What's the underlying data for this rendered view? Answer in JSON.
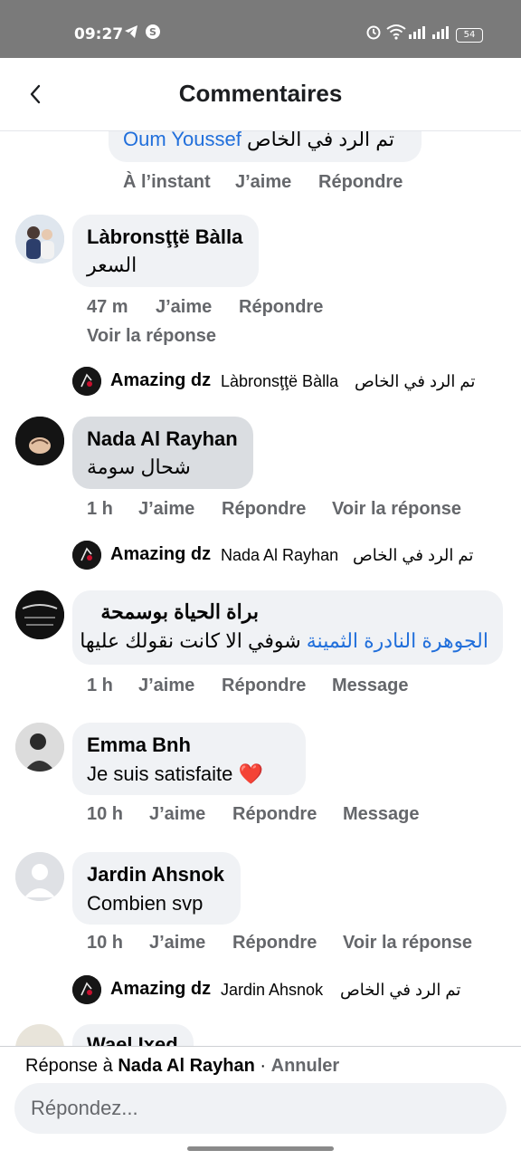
{
  "status": {
    "time": "09:27",
    "battery": "54",
    "icons": [
      "telegram-icon",
      "shazam-icon",
      "alarm-icon",
      "wifi-icon",
      "signal-icon",
      "signal-icon",
      "battery-icon"
    ]
  },
  "header": {
    "title": "Commentaires",
    "back_icon": "back-arrow-icon"
  },
  "comments": [
    {
      "reply_text_rtl": "تم الرد في الخاص",
      "mention": "Oum Youssef",
      "time": "À l’instant",
      "like": "J’aime",
      "reply": "Répondre"
    },
    {
      "name": "Làbronsţţë Bàlla",
      "text": "السعر",
      "time": "47 m",
      "like": "J’aime",
      "reply": "Répondre",
      "see_reply": "Voir la réponse",
      "sub_reply": {
        "name": "Amazing dz",
        "mention": "Làbronsţţë Bàlla",
        "text": "تم الرد في الخاص"
      }
    },
    {
      "name": "Nada Al Rayhan",
      "text": "شحال سومة",
      "time": "1 h",
      "like": "J’aime",
      "reply": "Répondre",
      "see_reply": "Voir la réponse",
      "sub_reply": {
        "name": "Amazing dz",
        "mention": "Nada Al Rayhan",
        "text": "تم الرد في الخاص"
      }
    },
    {
      "name": "براة الحياة بوسمحة",
      "mention": "الجوهرة النادرة الثمينة",
      "text": "شوفي الا كانت نقولك عليها",
      "time": "1 h",
      "like": "J’aime",
      "reply": "Répondre",
      "message": "Message"
    },
    {
      "name": "Emma Bnh",
      "text": "Je suis satisfaite ❤️",
      "time": "10 h",
      "like": "J’aime",
      "reply": "Répondre",
      "message": "Message"
    },
    {
      "name": "Jardin Ahsnok",
      "text": "Combien svp",
      "time": "10 h",
      "like": "J’aime",
      "reply": "Répondre",
      "see_reply": "Voir la réponse",
      "sub_reply": {
        "name": "Amazing dz",
        "mention": "Jardin Ahsnok",
        "text": "تم الرد في الخاص"
      }
    },
    {
      "name": "Wael Ixed"
    }
  ],
  "composer": {
    "reply_prefix": "Réponse à",
    "reply_target": "Nada Al Rayhan",
    "separator": " · ",
    "cancel": "Annuler",
    "placeholder": "Répondez..."
  },
  "colors": {
    "link": "#216fdb",
    "bubble": "#f0f2f5",
    "bubble_highlight": "#dadde1",
    "meta": "#65676b",
    "status_bar": "#7a7a7a"
  }
}
